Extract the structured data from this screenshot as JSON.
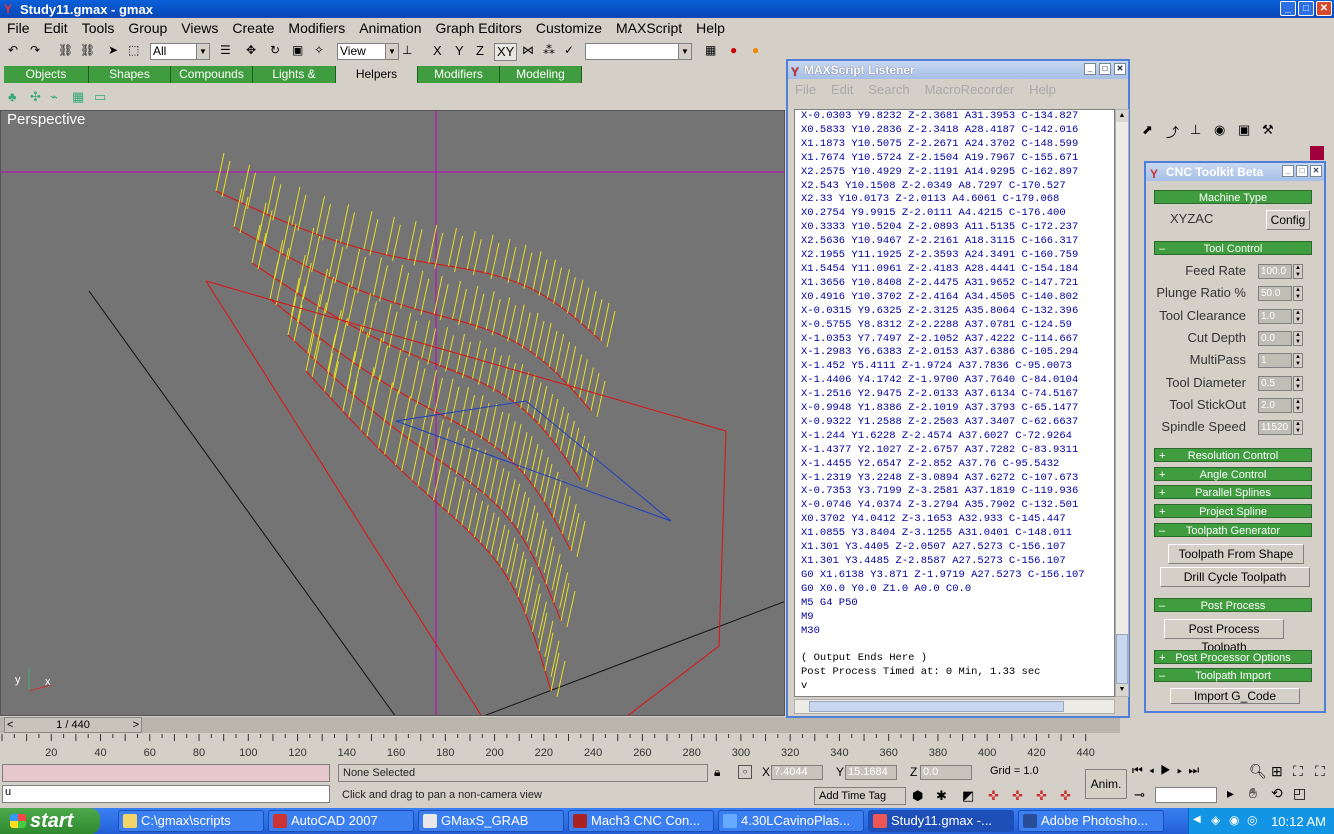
{
  "title": "Study11.gmax - gmax",
  "menu": [
    "File",
    "Edit",
    "Tools",
    "Group",
    "Views",
    "Create",
    "Modifiers",
    "Animation",
    "Graph Editors",
    "Customize",
    "MAXScript",
    "Help"
  ],
  "toolbar": {
    "selection_filter": "All",
    "ref_coord": "View",
    "axis_x": "X",
    "axis_y": "Y",
    "axis_z": "Z",
    "axis_xy": "XY"
  },
  "tabs": [
    "Objects",
    "Shapes",
    "Compounds",
    "Lights & Cameras",
    "Helpers",
    "Modifiers",
    "Modeling"
  ],
  "active_tab": "Helpers",
  "viewport": {
    "label": "Perspective"
  },
  "frame_slider": {
    "label": "1 / 440",
    "prev": "<",
    "next": ">"
  },
  "ruler_ticks": [
    "20",
    "40",
    "60",
    "80",
    "100",
    "120",
    "140",
    "160",
    "180",
    "200",
    "220",
    "240",
    "260",
    "280",
    "300",
    "320",
    "340",
    "360",
    "380",
    "400",
    "420",
    "440"
  ],
  "listener": {
    "title": "MAXScript Listener",
    "menu": [
      "File",
      "Edit",
      "Search",
      "MacroRecorder",
      "Help"
    ],
    "lines_blue": [
      "X-0.0303 Y9.8232 Z-2.3681 A31.3953 C-134.827",
      "X0.5833 Y10.2836 Z-2.3418 A28.4187 C-142.016",
      "X1.1873 Y10.5075 Z-2.2671 A24.3702 C-148.599",
      "X1.7674 Y10.5724 Z-2.1504 A19.7967 C-155.671",
      "X2.2575 Y10.4929 Z-2.1191 A14.9295 C-162.897",
      "X2.543 Y10.1508 Z-2.0349 A8.7297 C-170.527",
      "X2.33 Y10.0173 Z-2.0113 A4.6061 C-179.068",
      "X0.2754 Y9.9915 Z-2.0111 A4.4215 C-176.400",
      "X0.3333 Y10.5204 Z-2.0893 A11.5135 C-172.237",
      "X2.5636 Y10.9467 Z-2.2161 A18.3115 C-166.317",
      "X2.1955 Y11.1925 Z-2.3593 A24.3491 C-160.759",
      "X1.5454 Y11.0961 Z-2.4183 A28.4441 C-154.184",
      "X1.3656 Y10.8408 Z-2.4475 A31.9652 C-147.721",
      "X0.4916 Y10.3702 Z-2.4164 A34.4505 C-140.802",
      "X-0.0315 Y9.6325 Z-2.3125 A35.8064 C-132.396",
      "X-0.5755 Y8.8312 Z-2.2288 A37.0781 C-124.59",
      "X-1.0353 Y7.7497 Z-2.1052 A37.4222 C-114.667",
      "X-1.2983 Y6.6383 Z-2.0153 A37.6386 C-105.294",
      "X-1.452 Y5.4111 Z-1.9724 A37.7836 C-95.0073",
      "X-1.4406 Y4.1742 Z-1.9700 A37.7640 C-84.0104",
      "X-1.2516 Y2.9475 Z-2.0133 A37.6134 C-74.5167",
      "X-0.9948 Y1.8386 Z-2.1019 A37.3793 C-65.1477",
      "X-0.9322 Y1.2588 Z-2.2503 A37.3407 C-62.6637",
      "X-1.244 Y1.6228 Z-2.4574 A37.6027 C-72.9264",
      "X-1.4377 Y2.1027 Z-2.6757 A37.7282 C-83.9311",
      "X-1.4455 Y2.6547 Z-2.852 A37.76 C-95.5432",
      "X-1.2319 Y3.2248 Z-3.0894 A37.6272 C-107.673",
      "X-0.7353 Y3.7199 Z-3.2581 A37.1819 C-119.936",
      "X-0.0746 Y4.0374 Z-3.2794 A35.7902 C-132.501",
      "X0.3702 Y4.0412 Z-3.1653 A32.933 C-145.447",
      "X1.0855 Y3.8404 Z-3.1255 A31.0401 C-148.011",
      "X1.301 Y3.4405 Z-2.0507 A27.5273 C-156.107",
      "X1.301 Y3.4485 Z-2.8587 A27.5273 C-156.107",
      "G0 X1.6138 Y3.871 Z-1.9719 A27.5273 C-156.107",
      "G0 X0.0 Y0.0 Z1.0 A0.0 C0.0",
      "M5 G4 P50",
      "M9",
      "M30"
    ],
    "lines_black": [
      "",
      "( Output Ends Here )",
      "Post Process Timed at: 0 Min, 1.33 sec",
      "v"
    ]
  },
  "cnc": {
    "title": "CNC Toolkit Beta",
    "machine_type_header": "Machine Type",
    "machine_type": "XYZAC",
    "config_button": "Config",
    "tool_control_header": "Tool Control",
    "params": [
      {
        "label": "Feed Rate",
        "value": "100.0"
      },
      {
        "label": "Plunge Ratio %",
        "value": "50.0"
      },
      {
        "label": "Tool Clearance",
        "value": "1.0"
      },
      {
        "label": "Cut Depth",
        "value": "0.0"
      },
      {
        "label": "MultiPass",
        "value": "1"
      },
      {
        "label": "Tool Diameter",
        "value": "0.5"
      },
      {
        "label": "Tool StickOut",
        "value": "2.0"
      },
      {
        "label": "Spindle Speed",
        "value": "11520"
      }
    ],
    "collapsed": [
      "Resolution Control",
      "Angle Control",
      "Parallel Splines",
      "Project Spline"
    ],
    "toolpath_generator_header": "Toolpath Generator",
    "toolpath_from_shape": "Toolpath From Shape",
    "drill_cycle_toolpath": "Drill Cycle Toolpath",
    "post_process_header": "Post Process",
    "post_process_toolpath": "Post Process Toolpath",
    "post_processor_options": "Post Processor Options",
    "toolpath_import_header": "Toolpath Import",
    "import_gcode": "Import G_Code"
  },
  "status": {
    "selection": "None Selected",
    "prompt": "Click and drag to pan a non-camera view",
    "x_label": "X",
    "x_value": "7.4044",
    "y_label": "Y",
    "y_value": "15.1684",
    "z_label": "Z",
    "z_value": "0.0",
    "grid": "Grid = 1.0",
    "add_time_tag": "Add Time Tag",
    "anim": "Anim.",
    "script_input": "u"
  },
  "taskbar": {
    "start": "start",
    "items": [
      "C:\\gmax\\scripts",
      "AutoCAD 2007",
      "GMaxS_GRAB",
      "Mach3 CNC Con...",
      "4.30LCavinoPlas...",
      "Study11.gmax -...",
      "Adobe Photosho..."
    ],
    "clock": "10:12 AM"
  },
  "colors": {
    "accent_green": "#3f9d3f",
    "titlebar_blue": "#0a5fd8",
    "listener_text": "#0000a0",
    "viewport_bg": "#747474"
  }
}
